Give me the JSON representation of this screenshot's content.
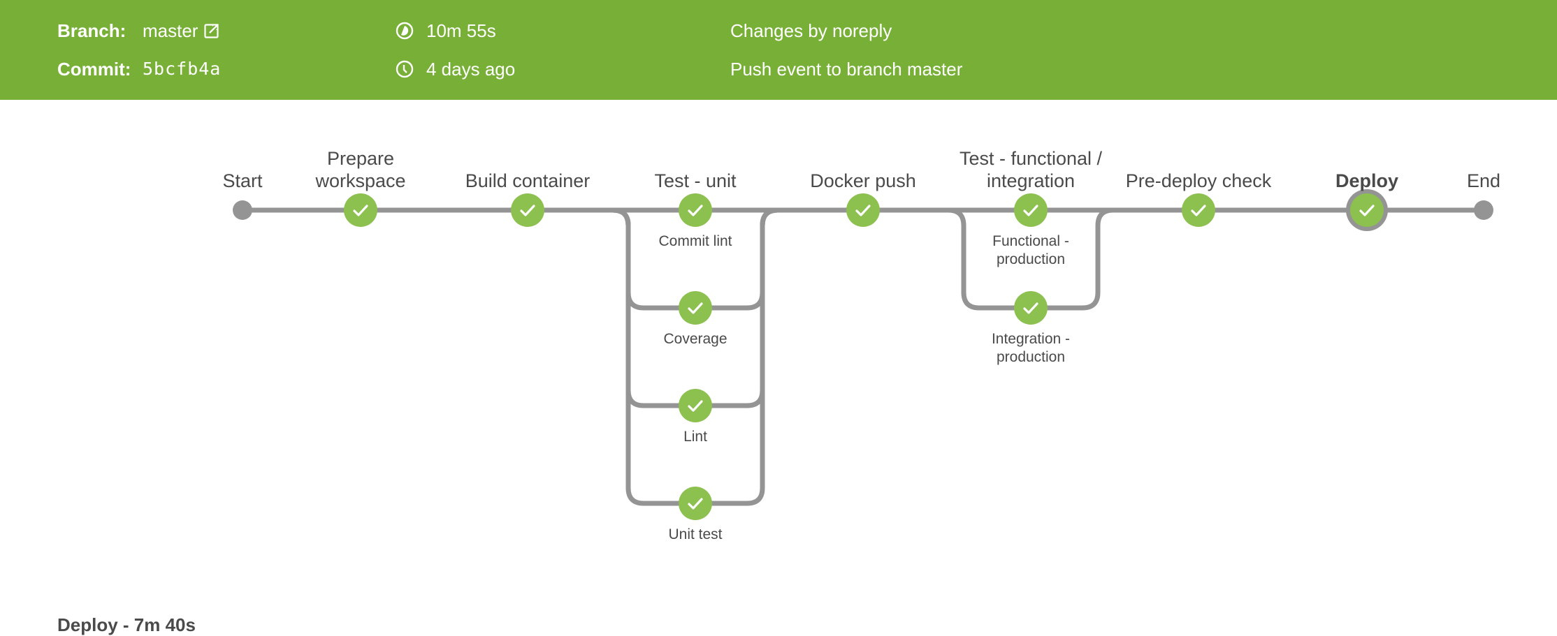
{
  "header": {
    "branch_label": "Branch:",
    "branch_value": "master",
    "branch_link_icon": "external-link-icon",
    "commit_label": "Commit:",
    "commit_value": "5bcfb4a",
    "duration_icon": "duration-pie-icon",
    "duration": "10m 55s",
    "time_icon": "clock-icon",
    "time_ago": "4 days ago",
    "changes": "Changes by noreply",
    "cause": "Push event to branch master",
    "background_color": "#78b037"
  },
  "pipeline": {
    "colors": {
      "success": "#8cc04f",
      "line": "#949494",
      "check": "#ffffff"
    },
    "stages": [
      {
        "id": "start",
        "label": "Start",
        "type": "terminal"
      },
      {
        "id": "prepare",
        "label": "Prepare\nworkspace",
        "status": "success"
      },
      {
        "id": "build",
        "label": "Build container",
        "status": "success"
      },
      {
        "id": "test-unit",
        "label": "Test - unit",
        "status": "success",
        "parallel": [
          "Commit lint",
          "Coverage",
          "Lint",
          "Unit test"
        ]
      },
      {
        "id": "docker",
        "label": "Docker push",
        "status": "success"
      },
      {
        "id": "test-func",
        "label": "Test - functional /\nintegration",
        "status": "success",
        "parallel": [
          "Functional -\nproduction",
          "Integration -\nproduction"
        ]
      },
      {
        "id": "predeploy",
        "label": "Pre-deploy check",
        "status": "success"
      },
      {
        "id": "deploy",
        "label": "Deploy",
        "status": "success",
        "selected": true
      },
      {
        "id": "end",
        "label": "End",
        "type": "terminal"
      }
    ]
  },
  "footer": {
    "selected_stage_title": "Deploy - 7m 40s"
  }
}
